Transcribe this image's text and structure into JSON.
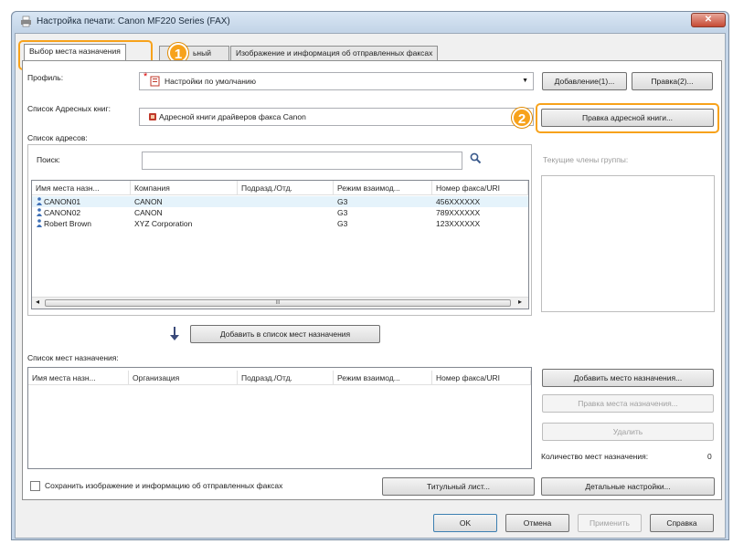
{
  "window": {
    "title": "Настройка печати: Canon MF220 Series (FAX)",
    "close_glyph": "✕"
  },
  "tabs": [
    {
      "label": "Выбор места назначения"
    },
    {
      "label": "ьный"
    },
    {
      "label": "Изображение и информация об отправленных факсах"
    }
  ],
  "badges": {
    "one": "1",
    "two": "2"
  },
  "profile": {
    "label": "Профиль:",
    "value": "Настройки по умолчанию",
    "marker": "*",
    "add_button": "Добавление(1)...",
    "edit_button": "Правка(2)..."
  },
  "address_book_list": {
    "label": "Список Адресных книг:",
    "value": "Адресной книги драйверов факса Canon",
    "edit_button": "Правка адресной книги..."
  },
  "addresses": {
    "label": "Список адресов:",
    "search_label": "Поиск:",
    "columns": [
      "Имя места назн...",
      "Компания",
      "Подразд./Отд.",
      "Режим взаимод...",
      "Номер факса/URI"
    ],
    "rows": [
      {
        "name": "CANON01",
        "company": "CANON",
        "dept": "",
        "mode": "G3",
        "fax": "456XXXXXX"
      },
      {
        "name": "CANON02",
        "company": "CANON",
        "dept": "",
        "mode": "G3",
        "fax": "789XXXXXX"
      },
      {
        "name": "Robert Brown",
        "company": "XYZ Corporation",
        "dept": "",
        "mode": "G3",
        "fax": "123XXXXXX"
      }
    ],
    "scroll_thumb_glyph": "III",
    "scroll_left_glyph": "◂",
    "scroll_right_glyph": "▸"
  },
  "group_members_label": "Текущие члены группы:",
  "add_to_destinations_button": "Добавить в список мест назначения",
  "destinations": {
    "label": "Список мест назначения:",
    "columns": [
      "Имя места назн...",
      "Организация",
      "Подразд./Отд.",
      "Режим взаимод...",
      "Номер факса/URI"
    ],
    "rows": []
  },
  "dest_buttons": {
    "add": "Добавить место назначения...",
    "edit": "Правка места назначения...",
    "delete": "Удалить"
  },
  "dest_count": {
    "label": "Количество мест назначения:",
    "value": "0"
  },
  "save_checkbox": {
    "label": "Сохранить изображение и информацию об отправленных факсах",
    "checked": false
  },
  "cover_sheet_button": "Титульный лист...",
  "details_button": "Детальные настройки...",
  "footer": {
    "ok": "OK",
    "cancel": "Отмена",
    "apply": "Применить",
    "help": "Справка"
  },
  "colors": {
    "accent_badge": "#f7a21b",
    "selected_row": "#e5f3fb",
    "window_frame": "#c4d5e8"
  }
}
